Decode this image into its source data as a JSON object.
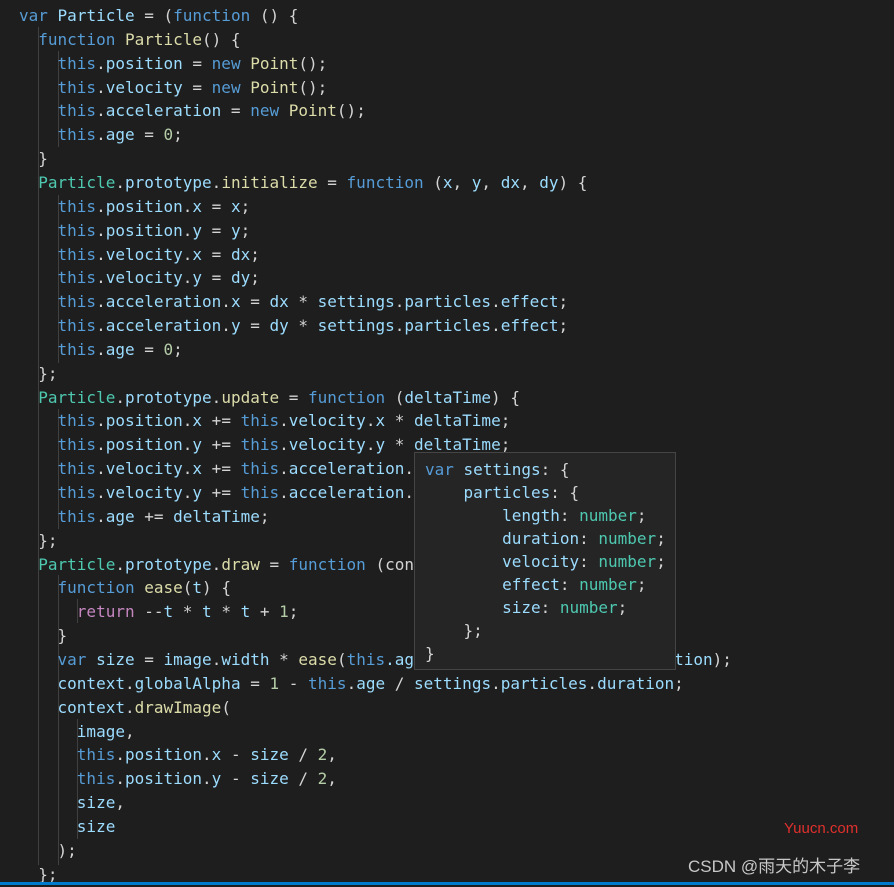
{
  "colors": {
    "background": "#1e1e1e",
    "keyword": "#569cd6",
    "control": "#c586c0",
    "variable": "#9cdcfe",
    "function": "#dcdcaa",
    "class": "#4ec9b0",
    "number": "#b5cea8",
    "text": "#d4d4d4"
  },
  "code_lines": [
    [
      [
        "var",
        "kw"
      ],
      [
        " ",
        "pun"
      ],
      [
        "Particle",
        "var"
      ],
      [
        " = (",
        "pun"
      ],
      [
        "function",
        "kw"
      ],
      [
        " () {",
        "pun"
      ]
    ],
    [
      [
        "  ",
        "pun"
      ],
      [
        "function",
        "kw"
      ],
      [
        " ",
        "pun"
      ],
      [
        "Particle",
        "fn"
      ],
      [
        "() {",
        "pun"
      ]
    ],
    [
      [
        "    ",
        "pun"
      ],
      [
        "this",
        "kw"
      ],
      [
        ".",
        "pun"
      ],
      [
        "position",
        "var"
      ],
      [
        " = ",
        "pun"
      ],
      [
        "new",
        "kw"
      ],
      [
        " ",
        "pun"
      ],
      [
        "Point",
        "fn"
      ],
      [
        "();",
        "pun"
      ]
    ],
    [
      [
        "    ",
        "pun"
      ],
      [
        "this",
        "kw"
      ],
      [
        ".",
        "pun"
      ],
      [
        "velocity",
        "var"
      ],
      [
        " = ",
        "pun"
      ],
      [
        "new",
        "kw"
      ],
      [
        " ",
        "pun"
      ],
      [
        "Point",
        "fn"
      ],
      [
        "();",
        "pun"
      ]
    ],
    [
      [
        "    ",
        "pun"
      ],
      [
        "this",
        "kw"
      ],
      [
        ".",
        "pun"
      ],
      [
        "acceleration",
        "var"
      ],
      [
        " = ",
        "pun"
      ],
      [
        "new",
        "kw"
      ],
      [
        " ",
        "pun"
      ],
      [
        "Point",
        "fn"
      ],
      [
        "();",
        "pun"
      ]
    ],
    [
      [
        "    ",
        "pun"
      ],
      [
        "this",
        "kw"
      ],
      [
        ".",
        "pun"
      ],
      [
        "age",
        "var"
      ],
      [
        " = ",
        "pun"
      ],
      [
        "0",
        "num"
      ],
      [
        ";",
        "pun"
      ]
    ],
    [
      [
        "  }",
        "pun"
      ]
    ],
    [
      [
        "  ",
        "pun"
      ],
      [
        "Particle",
        "cls"
      ],
      [
        ".",
        "pun"
      ],
      [
        "prototype",
        "var"
      ],
      [
        ".",
        "pun"
      ],
      [
        "initialize",
        "fn"
      ],
      [
        " = ",
        "pun"
      ],
      [
        "function",
        "kw"
      ],
      [
        " (",
        "pun"
      ],
      [
        "x",
        "var"
      ],
      [
        ", ",
        "pun"
      ],
      [
        "y",
        "var"
      ],
      [
        ", ",
        "pun"
      ],
      [
        "dx",
        "var"
      ],
      [
        ", ",
        "pun"
      ],
      [
        "dy",
        "var"
      ],
      [
        ") {",
        "pun"
      ]
    ],
    [
      [
        "    ",
        "pun"
      ],
      [
        "this",
        "kw"
      ],
      [
        ".",
        "pun"
      ],
      [
        "position",
        "var"
      ],
      [
        ".",
        "pun"
      ],
      [
        "x",
        "var"
      ],
      [
        " = ",
        "pun"
      ],
      [
        "x",
        "var"
      ],
      [
        ";",
        "pun"
      ]
    ],
    [
      [
        "    ",
        "pun"
      ],
      [
        "this",
        "kw"
      ],
      [
        ".",
        "pun"
      ],
      [
        "position",
        "var"
      ],
      [
        ".",
        "pun"
      ],
      [
        "y",
        "var"
      ],
      [
        " = ",
        "pun"
      ],
      [
        "y",
        "var"
      ],
      [
        ";",
        "pun"
      ]
    ],
    [
      [
        "    ",
        "pun"
      ],
      [
        "this",
        "kw"
      ],
      [
        ".",
        "pun"
      ],
      [
        "velocity",
        "var"
      ],
      [
        ".",
        "pun"
      ],
      [
        "x",
        "var"
      ],
      [
        " = ",
        "pun"
      ],
      [
        "dx",
        "var"
      ],
      [
        ";",
        "pun"
      ]
    ],
    [
      [
        "    ",
        "pun"
      ],
      [
        "this",
        "kw"
      ],
      [
        ".",
        "pun"
      ],
      [
        "velocity",
        "var"
      ],
      [
        ".",
        "pun"
      ],
      [
        "y",
        "var"
      ],
      [
        " = ",
        "pun"
      ],
      [
        "dy",
        "var"
      ],
      [
        ";",
        "pun"
      ]
    ],
    [
      [
        "    ",
        "pun"
      ],
      [
        "this",
        "kw"
      ],
      [
        ".",
        "pun"
      ],
      [
        "acceleration",
        "var"
      ],
      [
        ".",
        "pun"
      ],
      [
        "x",
        "var"
      ],
      [
        " = ",
        "pun"
      ],
      [
        "dx",
        "var"
      ],
      [
        " * ",
        "pun"
      ],
      [
        "settings",
        "var"
      ],
      [
        ".",
        "pun"
      ],
      [
        "particles",
        "var"
      ],
      [
        ".",
        "pun"
      ],
      [
        "effect",
        "var"
      ],
      [
        ";",
        "pun"
      ]
    ],
    [
      [
        "    ",
        "pun"
      ],
      [
        "this",
        "kw"
      ],
      [
        ".",
        "pun"
      ],
      [
        "acceleration",
        "var"
      ],
      [
        ".",
        "pun"
      ],
      [
        "y",
        "var"
      ],
      [
        " = ",
        "pun"
      ],
      [
        "dy",
        "var"
      ],
      [
        " * ",
        "pun"
      ],
      [
        "settings",
        "var"
      ],
      [
        ".",
        "pun"
      ],
      [
        "particles",
        "var"
      ],
      [
        ".",
        "pun"
      ],
      [
        "effect",
        "var"
      ],
      [
        ";",
        "pun"
      ]
    ],
    [
      [
        "    ",
        "pun"
      ],
      [
        "this",
        "kw"
      ],
      [
        ".",
        "pun"
      ],
      [
        "age",
        "var"
      ],
      [
        " = ",
        "pun"
      ],
      [
        "0",
        "num"
      ],
      [
        ";",
        "pun"
      ]
    ],
    [
      [
        "  };",
        "pun"
      ]
    ],
    [
      [
        "  ",
        "pun"
      ],
      [
        "Particle",
        "cls"
      ],
      [
        ".",
        "pun"
      ],
      [
        "prototype",
        "var"
      ],
      [
        ".",
        "pun"
      ],
      [
        "update",
        "fn"
      ],
      [
        " = ",
        "pun"
      ],
      [
        "function",
        "kw"
      ],
      [
        " (",
        "pun"
      ],
      [
        "deltaTime",
        "var"
      ],
      [
        ") {",
        "pun"
      ]
    ],
    [
      [
        "    ",
        "pun"
      ],
      [
        "this",
        "kw"
      ],
      [
        ".",
        "pun"
      ],
      [
        "position",
        "var"
      ],
      [
        ".",
        "pun"
      ],
      [
        "x",
        "var"
      ],
      [
        " += ",
        "pun"
      ],
      [
        "this",
        "kw"
      ],
      [
        ".",
        "pun"
      ],
      [
        "velocity",
        "var"
      ],
      [
        ".",
        "pun"
      ],
      [
        "x",
        "var"
      ],
      [
        " * ",
        "pun"
      ],
      [
        "deltaTime",
        "var"
      ],
      [
        ";",
        "pun"
      ]
    ],
    [
      [
        "    ",
        "pun"
      ],
      [
        "this",
        "kw"
      ],
      [
        ".",
        "pun"
      ],
      [
        "position",
        "var"
      ],
      [
        ".",
        "pun"
      ],
      [
        "y",
        "var"
      ],
      [
        " += ",
        "pun"
      ],
      [
        "this",
        "kw"
      ],
      [
        ".",
        "pun"
      ],
      [
        "velocity",
        "var"
      ],
      [
        ".",
        "pun"
      ],
      [
        "y",
        "var"
      ],
      [
        " * ",
        "pun"
      ],
      [
        "deltaTime",
        "var"
      ],
      [
        ";",
        "pun"
      ]
    ],
    [
      [
        "    ",
        "pun"
      ],
      [
        "this",
        "kw"
      ],
      [
        ".",
        "pun"
      ],
      [
        "velocity",
        "var"
      ],
      [
        ".",
        "pun"
      ],
      [
        "x",
        "var"
      ],
      [
        " += ",
        "pun"
      ],
      [
        "this",
        "kw"
      ],
      [
        ".",
        "pun"
      ],
      [
        "acceleration",
        "var"
      ],
      [
        ".",
        "pun"
      ]
    ],
    [
      [
        "    ",
        "pun"
      ],
      [
        "this",
        "kw"
      ],
      [
        ".",
        "pun"
      ],
      [
        "velocity",
        "var"
      ],
      [
        ".",
        "pun"
      ],
      [
        "y",
        "var"
      ],
      [
        " += ",
        "pun"
      ],
      [
        "this",
        "kw"
      ],
      [
        ".",
        "pun"
      ],
      [
        "acceleration",
        "var"
      ],
      [
        ".",
        "pun"
      ]
    ],
    [
      [
        "    ",
        "pun"
      ],
      [
        "this",
        "kw"
      ],
      [
        ".",
        "pun"
      ],
      [
        "age",
        "var"
      ],
      [
        " += ",
        "pun"
      ],
      [
        "deltaTime",
        "var"
      ],
      [
        ";",
        "pun"
      ]
    ],
    [
      [
        "  };",
        "pun"
      ]
    ],
    [
      [
        "  ",
        "pun"
      ],
      [
        "Particle",
        "cls"
      ],
      [
        ".",
        "pun"
      ],
      [
        "prototype",
        "var"
      ],
      [
        ".",
        "pun"
      ],
      [
        "draw",
        "fn"
      ],
      [
        " = ",
        "pun"
      ],
      [
        "function",
        "kw"
      ],
      [
        " (con",
        "pun"
      ]
    ],
    [
      [
        "    ",
        "pun"
      ],
      [
        "function",
        "kw"
      ],
      [
        " ",
        "pun"
      ],
      [
        "ease",
        "fn"
      ],
      [
        "(",
        "pun"
      ],
      [
        "t",
        "var"
      ],
      [
        ") {",
        "pun"
      ]
    ],
    [
      [
        "      ",
        "pun"
      ],
      [
        "return",
        "ctl"
      ],
      [
        " --",
        "pun"
      ],
      [
        "t",
        "var"
      ],
      [
        " * ",
        "pun"
      ],
      [
        "t",
        "var"
      ],
      [
        " * ",
        "pun"
      ],
      [
        "t",
        "var"
      ],
      [
        " + ",
        "pun"
      ],
      [
        "1",
        "num"
      ],
      [
        ";",
        "pun"
      ]
    ],
    [
      [
        "    }",
        "pun"
      ]
    ],
    [
      [
        "    ",
        "pun"
      ],
      [
        "var",
        "kw"
      ],
      [
        " ",
        "pun"
      ],
      [
        "size",
        "var"
      ],
      [
        " = ",
        "pun"
      ],
      [
        "image",
        "var"
      ],
      [
        ".",
        "pun"
      ],
      [
        "width",
        "var"
      ],
      [
        " * ",
        "pun"
      ],
      [
        "ease",
        "fn"
      ],
      [
        "(",
        "pun"
      ],
      [
        "this",
        "kw"
      ],
      [
        ".ag",
        "var"
      ],
      [
        "                           ",
        "pun"
      ],
      [
        "tion",
        "var"
      ],
      [
        ");",
        "pun"
      ]
    ],
    [
      [
        "    ",
        "pun"
      ],
      [
        "context",
        "var"
      ],
      [
        ".",
        "pun"
      ],
      [
        "globalAlpha",
        "var"
      ],
      [
        " = ",
        "pun"
      ],
      [
        "1",
        "num"
      ],
      [
        " - ",
        "pun"
      ],
      [
        "this",
        "kw"
      ],
      [
        ".",
        "pun"
      ],
      [
        "age",
        "var"
      ],
      [
        " / ",
        "pun"
      ],
      [
        "settings",
        "var"
      ],
      [
        ".",
        "pun"
      ],
      [
        "particles",
        "var"
      ],
      [
        ".",
        "pun"
      ],
      [
        "duration",
        "var"
      ],
      [
        ";",
        "pun"
      ]
    ],
    [
      [
        "    ",
        "pun"
      ],
      [
        "context",
        "var"
      ],
      [
        ".",
        "pun"
      ],
      [
        "drawImage",
        "fn"
      ],
      [
        "(",
        "pun"
      ]
    ],
    [
      [
        "      ",
        "pun"
      ],
      [
        "image",
        "var"
      ],
      [
        ",",
        "pun"
      ]
    ],
    [
      [
        "      ",
        "pun"
      ],
      [
        "this",
        "kw"
      ],
      [
        ".",
        "pun"
      ],
      [
        "position",
        "var"
      ],
      [
        ".",
        "pun"
      ],
      [
        "x",
        "var"
      ],
      [
        " - ",
        "pun"
      ],
      [
        "size",
        "var"
      ],
      [
        " / ",
        "pun"
      ],
      [
        "2",
        "num"
      ],
      [
        ",",
        "pun"
      ]
    ],
    [
      [
        "      ",
        "pun"
      ],
      [
        "this",
        "kw"
      ],
      [
        ".",
        "pun"
      ],
      [
        "position",
        "var"
      ],
      [
        ".",
        "pun"
      ],
      [
        "y",
        "var"
      ],
      [
        " - ",
        "pun"
      ],
      [
        "size",
        "var"
      ],
      [
        " / ",
        "pun"
      ],
      [
        "2",
        "num"
      ],
      [
        ",",
        "pun"
      ]
    ],
    [
      [
        "      ",
        "pun"
      ],
      [
        "size",
        "var"
      ],
      [
        ",",
        "pun"
      ]
    ],
    [
      [
        "      ",
        "pun"
      ],
      [
        "size",
        "var"
      ]
    ],
    [
      [
        "    );",
        "pun"
      ]
    ],
    [
      [
        "  };",
        "pun"
      ]
    ]
  ],
  "hover_lines": [
    [
      [
        "var",
        "kw"
      ],
      [
        " ",
        "pun"
      ],
      [
        "settings",
        "var"
      ],
      [
        ": {",
        "pun"
      ]
    ],
    [
      [
        "    ",
        "pun"
      ],
      [
        "particles",
        "var"
      ],
      [
        ": {",
        "pun"
      ]
    ],
    [
      [
        "        ",
        "pun"
      ],
      [
        "length",
        "var"
      ],
      [
        ": ",
        "pun"
      ],
      [
        "number",
        "cls"
      ],
      [
        ";",
        "pun"
      ]
    ],
    [
      [
        "        ",
        "pun"
      ],
      [
        "duration",
        "var"
      ],
      [
        ": ",
        "pun"
      ],
      [
        "number",
        "cls"
      ],
      [
        ";",
        "pun"
      ]
    ],
    [
      [
        "        ",
        "pun"
      ],
      [
        "velocity",
        "var"
      ],
      [
        ": ",
        "pun"
      ],
      [
        "number",
        "cls"
      ],
      [
        ";",
        "pun"
      ]
    ],
    [
      [
        "        ",
        "pun"
      ],
      [
        "effect",
        "var"
      ],
      [
        ": ",
        "pun"
      ],
      [
        "number",
        "cls"
      ],
      [
        ";",
        "pun"
      ]
    ],
    [
      [
        "        ",
        "pun"
      ],
      [
        "size",
        "var"
      ],
      [
        ": ",
        "pun"
      ],
      [
        "number",
        "cls"
      ],
      [
        ";",
        "pun"
      ]
    ],
    [
      [
        "    };",
        "pun"
      ]
    ],
    [
      [
        "}",
        "pun"
      ]
    ]
  ],
  "watermark_site": "Yuucn.com",
  "watermark_author": "CSDN @雨天的木子李"
}
